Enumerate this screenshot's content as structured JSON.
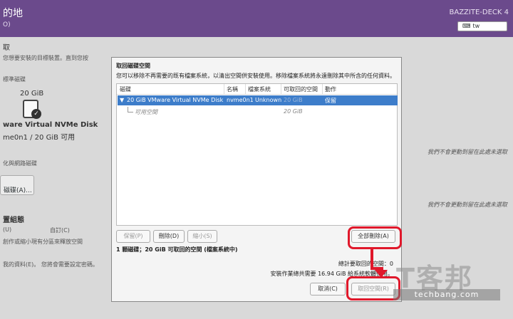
{
  "background": {
    "header_title": "的地",
    "header_subtitle": "O)",
    "product": "BAZZITE-DECK 4",
    "keyboard_value": "tw",
    "section_title": "取",
    "instruction": "您想要安裝的目標裝置。直到您按",
    "local_disks_label": "標準磁碟",
    "disk_size": "20 GiB",
    "disk_name": "ware Virtual NVMe Disk",
    "disk_info": "me0n1  /  20 GiB 可用",
    "network_label": "化與網路磁碟",
    "add_disk_button": "磁碟(A)...",
    "storage_config": "置組態",
    "auto_option": "(U)",
    "custom_option": "自訂(C)",
    "hint_left": "創作或縮小現有分區來釋放空間",
    "hint_right_1": "我們不會更動到留在此處未選取",
    "hint_right_2": "我們不會更動到留在此處未選取",
    "encrypt_text": "我的資料(E)。  您將會需要設定密碼。"
  },
  "dialog": {
    "title": "取回磁碟空間",
    "description": "您可以移除不再需要的既有檔案系統，以清出空間供安裝使用。移除檔案系統將永遠刪除其中所含的任何資料。",
    "columns": [
      "磁碟",
      "名稱",
      "檔案系統",
      "可取回的空間",
      "動作"
    ],
    "rows": [
      {
        "disk": "20 GiB VMware Virtual NVMe Disk",
        "name": "nvme0n1",
        "fs": "Unknown",
        "reclaimable": "20 GiB",
        "action": "保留"
      },
      {
        "disk": "可用空間",
        "name": "",
        "fs": "",
        "reclaimable": "20 GiB",
        "action": ""
      }
    ],
    "buttons": {
      "keep": "保留(P)",
      "delete": "刪除(D)",
      "shrink": "縮小(S)",
      "delete_all": "全部刪除(A)",
      "cancel": "取消(C)",
      "reclaim": "取回空間(R)"
    },
    "summary_left": "1 顆磁碟；20 GiB 可取回的空間 (檔案系統中)",
    "summary_total": "總計要取回的空間：0",
    "summary_install": "安裝作業總共需要 16.94 GiB 給系統軟體使用。"
  },
  "watermark": {
    "logo": "T客邦",
    "site": "techbang.com"
  },
  "colors": {
    "header": "#6b4a8c",
    "selection": "#3d7dca",
    "highlight": "#e0182b"
  }
}
